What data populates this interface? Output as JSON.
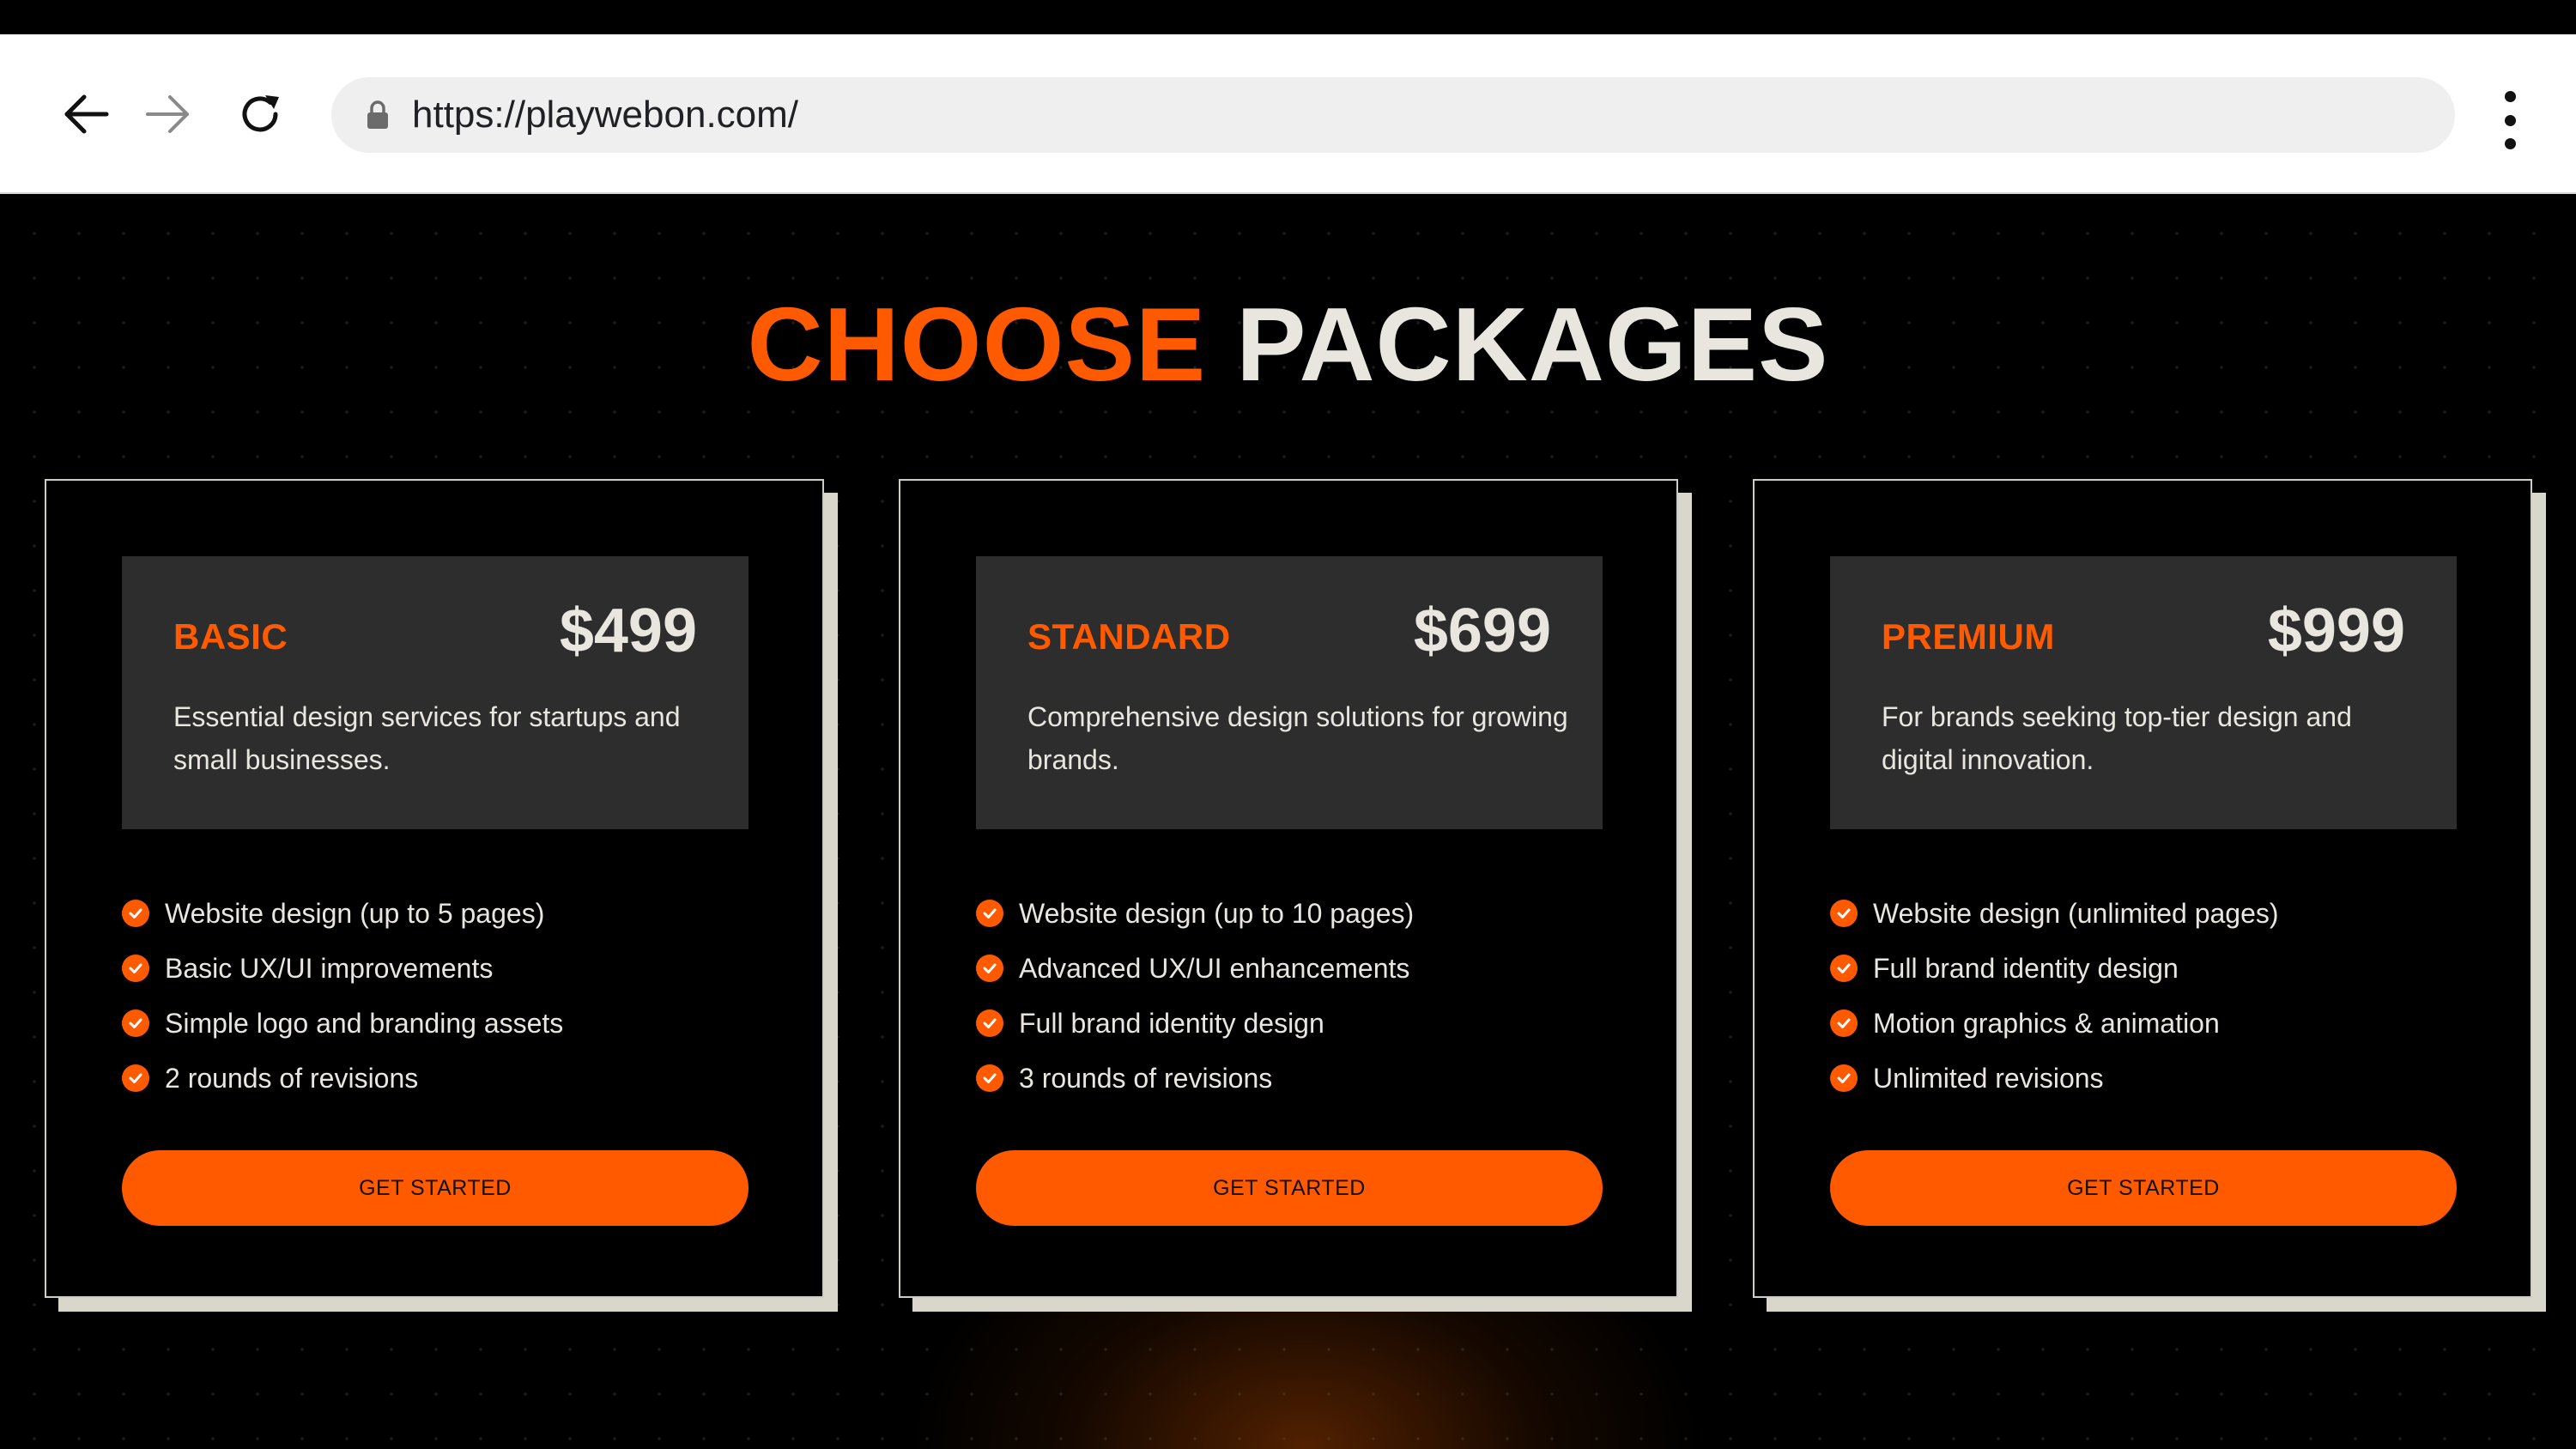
{
  "browser": {
    "url": "https://playwebon.com/",
    "back_icon": "arrow-left-icon",
    "forward_icon": "arrow-right-icon",
    "reload_icon": "reload-icon",
    "lock_icon": "lock-icon",
    "menu_icon": "kebab-menu-icon"
  },
  "section": {
    "title_accent": "CHOOSE",
    "title_rest": "PACKAGES"
  },
  "colors": {
    "accent": "#ff5a00",
    "background": "#000000",
    "card_header": "#2d2d2d",
    "text_light": "#e8e6df"
  },
  "packages": [
    {
      "name": "BASIC",
      "price": "$499",
      "description": "Essential design services for startups and small businesses.",
      "features": [
        "Website design (up to 5 pages)",
        "Basic UX/UI improvements",
        "Simple logo and branding assets",
        "2 rounds of revisions"
      ],
      "cta": "GET STARTED"
    },
    {
      "name": "STANDARD",
      "price": "$699",
      "description": "Comprehensive design solutions for growing brands.",
      "features": [
        "Website design (up to 10 pages)",
        "Advanced UX/UI enhancements",
        "Full brand identity design",
        "3 rounds of revisions"
      ],
      "cta": "GET STARTED"
    },
    {
      "name": "PREMIUM",
      "price": "$999",
      "description": "For brands seeking top-tier design and digital innovation.",
      "features": [
        "Website design (unlimited pages)",
        "Full brand identity design",
        "Motion graphics & animation",
        "Unlimited revisions"
      ],
      "cta": "GET STARTED"
    }
  ]
}
